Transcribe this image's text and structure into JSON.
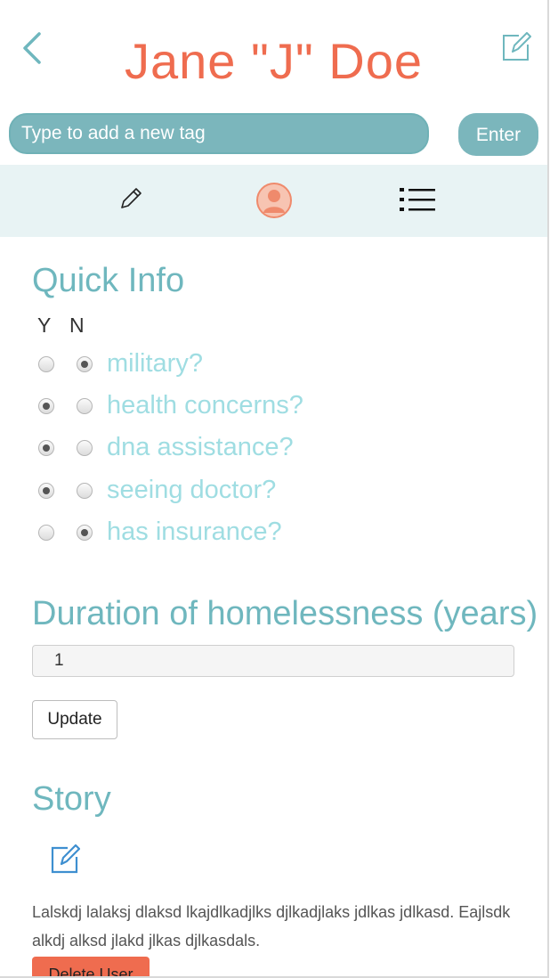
{
  "header": {
    "title": "Jane \"J\" Doe",
    "back_icon": "chevron-left-icon",
    "edit_icon": "edit-icon"
  },
  "tag_bar": {
    "placeholder": "Type to add a new tag",
    "enter_label": "Enter"
  },
  "nav": {
    "items": [
      {
        "icon": "pencil-icon"
      },
      {
        "icon": "user-avatar-icon",
        "active": true
      },
      {
        "icon": "list-icon"
      }
    ]
  },
  "quick_info": {
    "title": "Quick Info",
    "yes_label": "Y",
    "no_label": "N",
    "questions": [
      {
        "label": "military?",
        "answer": "N"
      },
      {
        "label": "health concerns?",
        "answer": "Y"
      },
      {
        "label": "dna assistance?",
        "answer": "Y"
      },
      {
        "label": "seeing doctor?",
        "answer": "Y"
      },
      {
        "label": "has insurance?",
        "answer": "N"
      }
    ]
  },
  "duration": {
    "title": "Duration of homelessness (years)",
    "value": "1",
    "update_label": "Update"
  },
  "story": {
    "title": "Story",
    "text": "Lalskdj lalaksj dlaksd lkajdlkadjlks djlkadjlaks jdlkas jdlkasd. Eajlsdk alkdj alksd jlakd jlkas djlkasdals.",
    "delete_label": "Delete User"
  },
  "colors": {
    "accent_orange": "#ef6c4f",
    "accent_teal": "#7bb6bc",
    "nav_bg": "#e8f3f4",
    "question_text": "#9fdde2"
  }
}
